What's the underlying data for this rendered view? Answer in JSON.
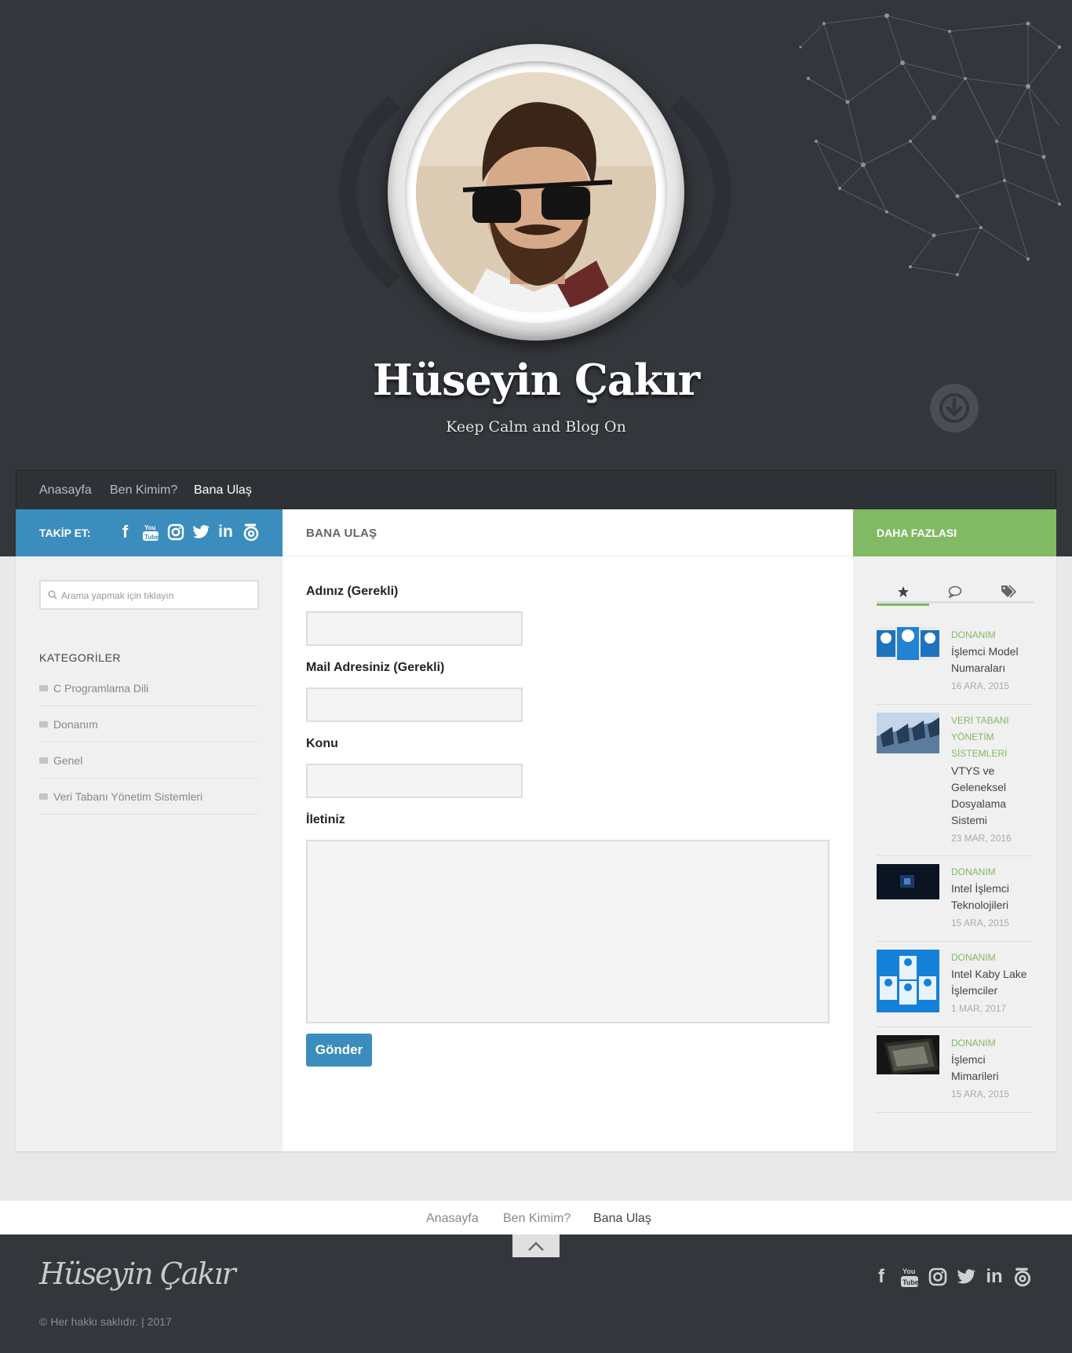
{
  "header": {
    "title": "Hüseyin Çakır",
    "description": "Keep Calm and Blog On"
  },
  "nav": {
    "items": [
      {
        "label": "Anasayfa",
        "active": false
      },
      {
        "label": "Ben Kimim?",
        "active": false
      },
      {
        "label": "Bana Ulaş",
        "active": true
      }
    ]
  },
  "left": {
    "follow_title": "TAKİP ET:",
    "social_icons": [
      "facebook-icon",
      "youtube-icon",
      "instagram-icon",
      "twitter-icon",
      "linkedin-icon",
      "blog-icon"
    ],
    "search_placeholder": "Arama yapmak için tıklayın",
    "categories_title": "KATEGORİLER",
    "categories": [
      "C Programlama Dili",
      "Donanım",
      "Genel",
      "Veri Tabanı Yönetim Sistemleri"
    ]
  },
  "center": {
    "page_title": "BANA ULAŞ",
    "form": {
      "name_label": "Adınız (Gerekli)",
      "email_label": "Mail Adresiniz (Gerekli)",
      "subject_label": "Konu",
      "message_label": "İletiniz",
      "submit_label": "Gönder"
    }
  },
  "right": {
    "title": "DAHA FAZLASI",
    "tabs": [
      "star-icon",
      "comments-icon",
      "tags-icon"
    ],
    "posts": [
      {
        "category": "DONANIM",
        "title_lines": [
          "İşlemci Model",
          "Numaraları"
        ],
        "date": "16 ARA, 2015",
        "thumb": "intel-chips"
      },
      {
        "category_lines": [
          "VERİ TABANI",
          "YÖNETİM",
          "SİSTEMLERİ"
        ],
        "title_lines": [
          "VTYS ve",
          "Geleneksel",
          "Dosyalama",
          "Sistemi"
        ],
        "date": "23 MAR, 2016",
        "thumb": "server-racks"
      },
      {
        "category": "DONANIM",
        "title_lines": [
          "Intel İşlemci",
          "Teknolojileri"
        ],
        "date": "15 ARA, 2015",
        "thumb": "dark-chip"
      },
      {
        "category": "DONANIM",
        "title_lines": [
          "Intel Kaby Lake",
          "İşlemciler"
        ],
        "date": "1 MAR, 2017",
        "thumb": "intel-boxes"
      },
      {
        "category": "DONANIM",
        "title_lines": [
          "İşlemci",
          "Mimarileri"
        ],
        "date": "15 ARA, 2015",
        "thumb": "cpu-pins"
      }
    ]
  },
  "footer": {
    "nav": [
      "Anasayfa",
      "Ben Kimim?",
      "Bana Ulaş"
    ],
    "signature": "Hüseyin Çakır",
    "copyright": "© Her hakkı saklıdır. | 2017"
  },
  "colors": {
    "dark_bg": "#33363b",
    "blue": "#3b8dbd",
    "green": "#82b965"
  }
}
